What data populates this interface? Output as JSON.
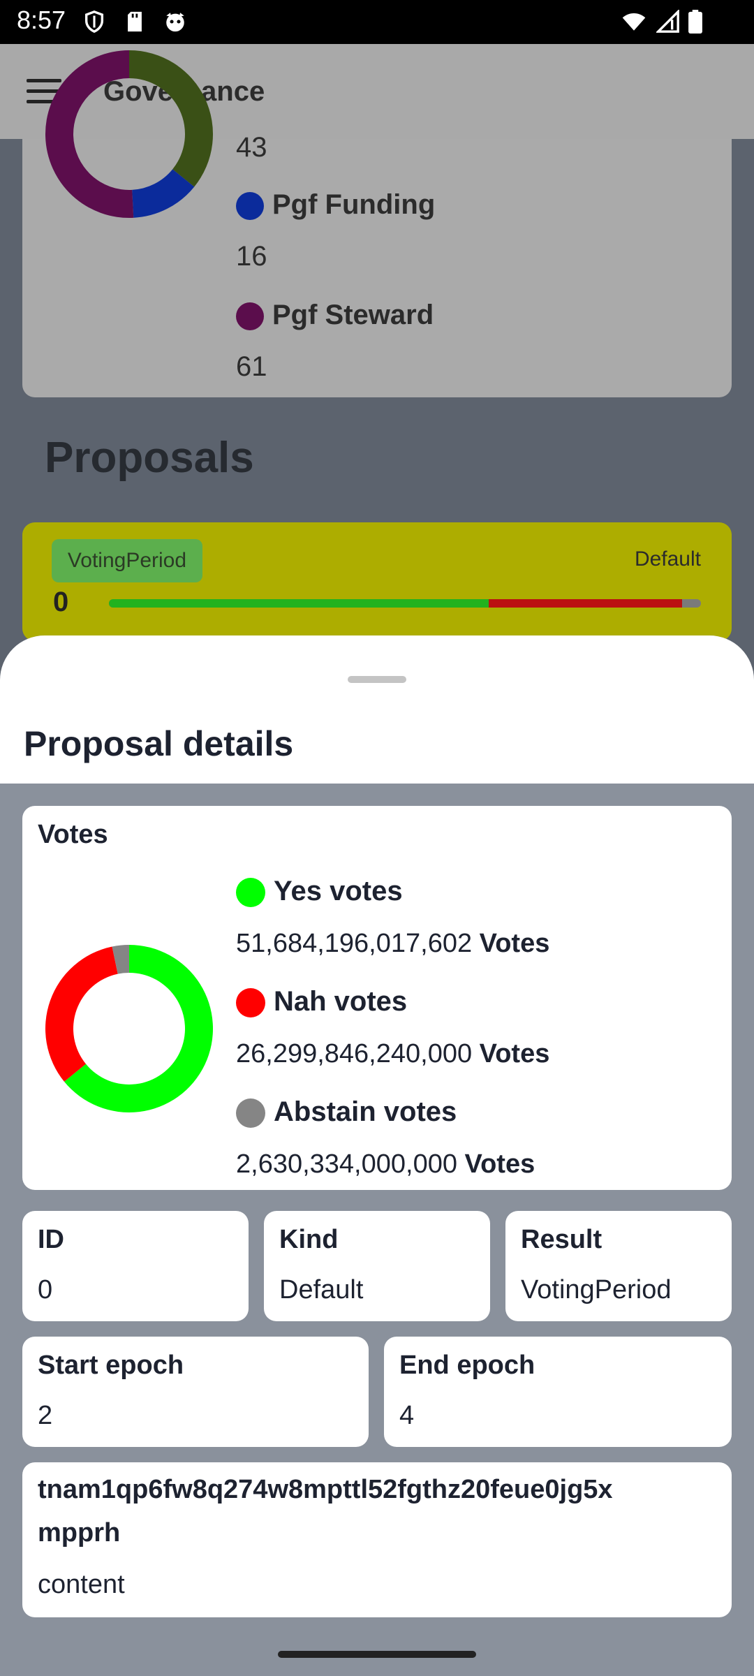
{
  "status_bar": {
    "time": "8:57",
    "left_icons": [
      "shield-icon",
      "sd-card-icon",
      "cat-face-icon"
    ],
    "right_icons": [
      "wifi-icon",
      "signal-icon",
      "battery-icon"
    ]
  },
  "app_bar": {
    "title": "Governance",
    "menu_icon": "menu-icon"
  },
  "background": {
    "kinds_chart": {
      "partial_value": "43",
      "legend": [
        {
          "label": "Pgf Funding",
          "value": "16",
          "color": "#0b2b9b"
        },
        {
          "label": "Pgf Steward",
          "value": "61",
          "color": "#5b0d4c"
        }
      ],
      "top_series_color": "#3a5016"
    },
    "proposals_heading": "Proposals",
    "proposal_card": {
      "status_badge": "VotingPeriod",
      "kind": "Default",
      "id": "0",
      "bar_colors": {
        "yes": "#22b21e",
        "nah": "#bb1111",
        "abstain": "#7a7a7a"
      }
    }
  },
  "sheet": {
    "title": "Proposal details",
    "votes_card": {
      "title": "Votes",
      "unit_label": "Votes",
      "items": [
        {
          "label": "Yes votes",
          "value": "51,684,196,017,602",
          "color": "#00ff00"
        },
        {
          "label": "Nah votes",
          "value": "26,299,846,240,000",
          "color": "#ff0000"
        },
        {
          "label": "Abstain votes",
          "value": "2,630,334,000,000",
          "color": "#858585"
        }
      ]
    },
    "info_cards": {
      "id": {
        "label": "ID",
        "value": "0"
      },
      "kind": {
        "label": "Kind",
        "value": "Default"
      },
      "result": {
        "label": "Result",
        "value": "VotingPeriod"
      },
      "start_epoch": {
        "label": "Start epoch",
        "value": "2"
      },
      "end_epoch": {
        "label": "End epoch",
        "value": "4"
      }
    },
    "author_card": {
      "address_line1": "tnam1qp6fw8q274w8mpttl52fgthz20feue0jg5x",
      "address_line2": "mpprh",
      "content_label": "content"
    }
  },
  "chart_data": [
    {
      "type": "pie",
      "title": "Votes",
      "categories": [
        "Yes votes",
        "Nah votes",
        "Abstain votes"
      ],
      "values": [
        51684196017602,
        26299846240000,
        2630334000000
      ],
      "colors": [
        "#00ff00",
        "#ff0000",
        "#858585"
      ]
    },
    {
      "type": "pie",
      "categories": [
        "",
        "Pgf Funding",
        "Pgf Steward"
      ],
      "values": [
        43,
        16,
        61
      ],
      "colors": [
        "#3a5016",
        "#0b2b9b",
        "#5b0d4c"
      ]
    }
  ]
}
